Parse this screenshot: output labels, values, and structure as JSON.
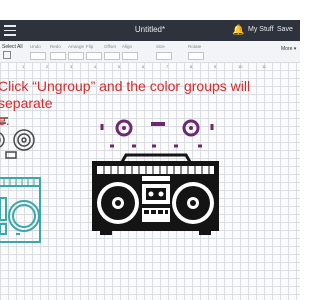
{
  "window": {
    "title": "Untitled*"
  },
  "header": {
    "my_stuff_label": "My Stuff",
    "save_label": "Save"
  },
  "toolbar": {
    "select_all_label": "Select All",
    "more_label": "More",
    "tools": [
      "Undo",
      "Redo",
      "Arrange",
      "Flip",
      "Offset",
      "Align",
      "Size",
      "Rotate"
    ]
  },
  "rulers": {
    "numbers": [
      "1",
      "2",
      "3",
      "4",
      "5",
      "6",
      "7",
      "8",
      "9",
      "10",
      "11"
    ]
  },
  "instruction": {
    "line1": "Click “Ungroup” and the color groups will separate",
    "line2": "e."
  },
  "colors": {
    "topbar": "#2d323c",
    "canvas_grid": "#dadde2",
    "instruction_text": "#d42b2b",
    "teal_group": "#3aa8a8",
    "purple_group": "#6b2a6f",
    "black_group": "#141414"
  },
  "icons": [
    "hamburger-menu-icon",
    "bell-icon",
    "user-icon",
    "select-all-icon"
  ]
}
